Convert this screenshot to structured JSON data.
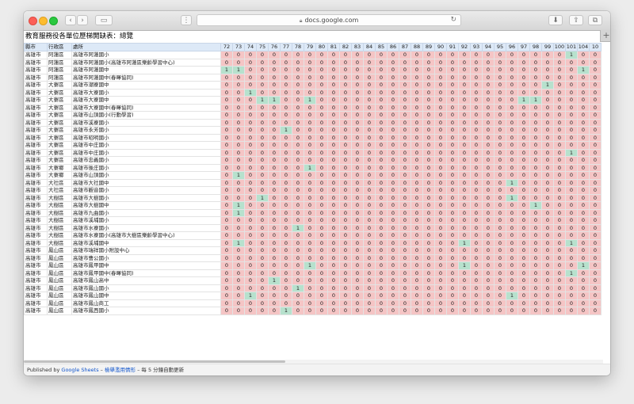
{
  "browser": {
    "address": "docs.google.com",
    "back_glyph": "‹",
    "forward_glyph": "›",
    "sidebar_glyph": "▭",
    "share_glyph": "⇪",
    "tabs_glyph": "⧉",
    "download_glyph": "⬇",
    "reload_glyph": "↻",
    "more_glyph": "⋮",
    "new_tab_glyph": "+"
  },
  "sheet": {
    "title": "教育服務役各單位歷梯開缺表：總覽",
    "headers": [
      "縣市",
      "行政區",
      "處所"
    ],
    "number_headers": [
      "72",
      "73",
      "74",
      "75",
      "76",
      "77",
      "78",
      "79",
      "80",
      "81",
      "82",
      "83",
      "84",
      "85",
      "86",
      "87",
      "88",
      "89",
      "90",
      "91",
      "92",
      "93",
      "94",
      "95",
      "96",
      "97",
      "98",
      "99",
      "100",
      "101",
      "104",
      "10"
    ],
    "rows": [
      {
        "city": "高雄市",
        "district": "阿蓮區",
        "site": "高雄市阿蓮國小",
        "v": "0000000000000000000000000000010"
      },
      {
        "city": "高雄市",
        "district": "阿蓮區",
        "site": "高雄市阿蓮國小(高雄市阿蓮區樂齡學習中心)",
        "v": "0000000000000000000000000000000"
      },
      {
        "city": "高雄市",
        "district": "阿蓮區",
        "site": "高雄市阿蓮國中",
        "v": "1100000000000000000000000000001"
      },
      {
        "city": "高雄市",
        "district": "阿蓮區",
        "site": "高雄市阿蓮國中(春暉協同)",
        "v": "0000000000000000000000000000000"
      },
      {
        "city": "高雄市",
        "district": "大寮區",
        "site": "高雄市潮寮國中",
        "v": "0000000000000000000000000001000"
      },
      {
        "city": "高雄市",
        "district": "大寮區",
        "site": "高雄市大寮國小",
        "v": "0010000000000000000000000000000"
      },
      {
        "city": "高雄市",
        "district": "大寮區",
        "site": "高雄市大寮國中",
        "v": "0001100100000000000000000110000"
      },
      {
        "city": "高雄市",
        "district": "大寮區",
        "site": "高雄市大寮國中(春暉協同)",
        "v": "0000000000000000000000000000000"
      },
      {
        "city": "高雄市",
        "district": "大寮區",
        "site": "高雄市山頂國小(行動學習)",
        "v": "0000000000000000000000000000000"
      },
      {
        "city": "高雄市",
        "district": "大寮區",
        "site": "高雄市溪寮國小",
        "v": "0000000000000000000000000000000"
      },
      {
        "city": "高雄市",
        "district": "大寮區",
        "site": "高雄市永芳國小",
        "v": "0000010000000000000000000000000"
      },
      {
        "city": "高雄市",
        "district": "大寮區",
        "site": "高雄市昭明國小",
        "v": "0000000000000000000000000000000"
      },
      {
        "city": "高雄市",
        "district": "大寮區",
        "site": "高雄市中庄國小",
        "v": "0000000000000000000000000000000"
      },
      {
        "city": "高雄市",
        "district": "大寮區",
        "site": "高雄市中庄國小",
        "v": "0000000000000000000000000000010"
      },
      {
        "city": "高雄市",
        "district": "大寮區",
        "site": "高雄市忠義國小",
        "v": "0000000000000000000000000000000"
      },
      {
        "city": "高雄市",
        "district": "大寮鄉",
        "site": "高雄市後庄國小",
        "v": "0000000100000000000000000000000"
      },
      {
        "city": "高雄市",
        "district": "大寮鄉",
        "site": "高雄市山頂國小",
        "v": "0100000000000000000000000000000"
      },
      {
        "city": "高雄市",
        "district": "大社區",
        "site": "高雄市大社國中",
        "v": "0000000000000000000000001000000"
      },
      {
        "city": "高雄市",
        "district": "大社區",
        "site": "高雄市觀音國小",
        "v": "0000000000000000000000000000000"
      },
      {
        "city": "高雄市",
        "district": "大樹區",
        "site": "高雄市大樹國小",
        "v": "0001000000000000000000001000000"
      },
      {
        "city": "高雄市",
        "district": "大樹區",
        "site": "高雄市大樹國中",
        "v": "0100000000000000000000000010000"
      },
      {
        "city": "高雄市",
        "district": "大樹區",
        "site": "高雄市九曲國小",
        "v": "0100000000000000000000000000000"
      },
      {
        "city": "高雄市",
        "district": "大樹區",
        "site": "高雄市溪埔國小",
        "v": "0000000000000000000000000000000"
      },
      {
        "city": "高雄市",
        "district": "大樹區",
        "site": "高雄市水寮國小",
        "v": "0000001000000000000000000000000"
      },
      {
        "city": "高雄市",
        "district": "大樹區",
        "site": "高雄市水寮國小(高雄市大樹區樂齡學習中心)",
        "v": "0000000000000000000000000000000"
      },
      {
        "city": "高雄市",
        "district": "大樹區",
        "site": "高雄市溪埔國中",
        "v": "0100000000000000000010000000010"
      },
      {
        "city": "高雄市",
        "district": "鳳山區",
        "site": "高雄市瑞祥國小附設中心",
        "v": "0000000000000000000000000000000"
      },
      {
        "city": "高雄市",
        "district": "鳳山區",
        "site": "高雄市曹公國小",
        "v": "0000000000000000000000000000000"
      },
      {
        "city": "高雄市",
        "district": "鳳山區",
        "site": "高雄市鳳甲國中",
        "v": "0000000100000000000010000000001"
      },
      {
        "city": "高雄市",
        "district": "鳳山區",
        "site": "高雄市鳳甲國中(春暉協同)",
        "v": "0000000000000000000000000000010"
      },
      {
        "city": "高雄市",
        "district": "鳳山區",
        "site": "高雄市鳳山高中",
        "v": "0000100000000000000000000000000"
      },
      {
        "city": "高雄市",
        "district": "鳳山區",
        "site": "高雄市鳳山國小",
        "v": "0000001000000000000000000000000"
      },
      {
        "city": "高雄市",
        "district": "鳳山區",
        "site": "高雄市鳳山國中",
        "v": "0010000000000000000000001000000"
      },
      {
        "city": "高雄市",
        "district": "鳳山區",
        "site": "高雄市鳳山商工",
        "v": "0000000000000000000000000000000"
      },
      {
        "city": "高雄市",
        "district": "鳳山區",
        "site": "高雄市鳳西國小",
        "v": "0000010000000000000000000000000"
      }
    ]
  },
  "footer": {
    "prefix": "Published by",
    "brand": "Google Sheets",
    "sep1": "–",
    "doc_link": "檢舉濫用情形",
    "sep2": "–",
    "note": "每 5 分鐘自動更新"
  },
  "colors": {
    "zero_fill": "#f5c5c5",
    "one_fill": "#b7e1cd",
    "header_fill": "#dde9f7",
    "link": "#1155cc"
  }
}
